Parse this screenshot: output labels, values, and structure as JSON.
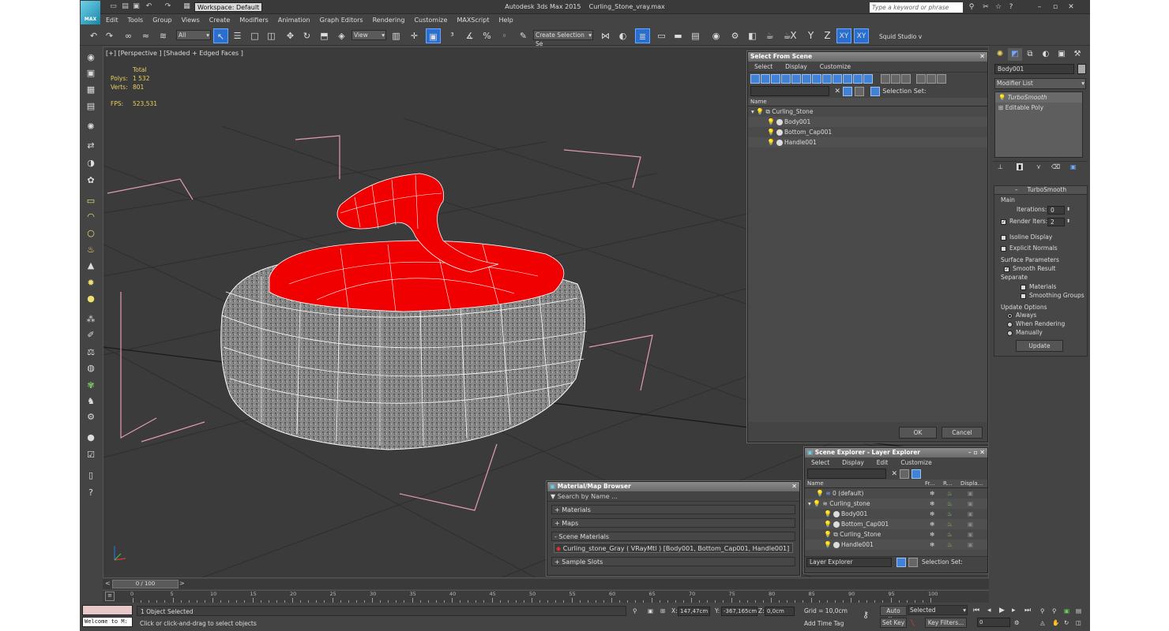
{
  "title": {
    "app": "Autodesk 3ds Max  2015",
    "file": "Curling_Stone_vray.max",
    "logo_text": "MAX",
    "workspace": "Workspace: Default",
    "search_placeholder": "Type a keyword or phrase"
  },
  "menu": [
    "Edit",
    "Tools",
    "Group",
    "Views",
    "Create",
    "Modifiers",
    "Animation",
    "Graph Editors",
    "Rendering",
    "Customize",
    "MAXScript",
    "Help"
  ],
  "toolbar": {
    "filter": "All",
    "ref_coord": "View",
    "selection_set": "Create Selection Se",
    "axes": [
      "X",
      "Y",
      "Z",
      "XY",
      "XY"
    ],
    "squid": "Squid Studio v"
  },
  "viewport": {
    "label": "[+] [Perspective ] [Shaded + Edged Faces ]",
    "stats": {
      "total_label": "Total",
      "polys_label": "Polys:",
      "polys": "1 532",
      "verts_label": "Verts:",
      "verts": "801",
      "fps_label": "FPS:",
      "fps": "523,531"
    }
  },
  "command_panel": {
    "object_name": "Body001",
    "modifier_list": "Modifier List",
    "stack": [
      "TurboSmooth",
      "Editable Poly"
    ],
    "rollout_title": "TurboSmooth",
    "main": "Main",
    "iterations_label": "Iterations:",
    "iterations": "0",
    "render_iters_label": "Render Iters:",
    "render_iters": "2",
    "isoline": "Isoline Display",
    "explicit_normals": "Explicit Normals",
    "surface_params": "Surface Parameters",
    "smooth_result": "Smooth Result",
    "separate": "Separate",
    "materials": "Materials",
    "smoothing_groups": "Smoothing Groups",
    "update_options": "Update Options",
    "always": "Always",
    "when_rendering": "When Rendering",
    "manually": "Manually",
    "update_btn": "Update"
  },
  "select_from_scene": {
    "title": "Select From Scene",
    "menu": [
      "Select",
      "Display",
      "Customize"
    ],
    "selection_set": "Selection Set:",
    "col_name": "Name",
    "rows": [
      "Curling_Stone",
      "Body001",
      "Bottom_Cap001",
      "Handle001"
    ],
    "ok": "OK",
    "cancel": "Cancel"
  },
  "scene_explorer": {
    "title": "Scene Explorer - Layer Explorer",
    "menu": [
      "Select",
      "Display",
      "Edit",
      "Customize"
    ],
    "cols": [
      "Name",
      "Fr...",
      "R...",
      "Displa..."
    ],
    "rows": [
      "0 (default)",
      "Curling_stone",
      "Body001",
      "Bottom_Cap001",
      "Curling_Stone",
      "Handle001"
    ],
    "footer_combo": "Layer Explorer",
    "footer_set": "Selection Set:"
  },
  "material_browser": {
    "title": "Material/Map Browser",
    "search": "Search by Name ...",
    "sections": [
      "+ Materials",
      "+ Maps",
      "- Scene Materials",
      "+ Sample Slots"
    ],
    "material": "Curling_stone_Gray  ( VRayMtl ) [Body001, Bottom_Cap001, Handle001]"
  },
  "timeline": {
    "frame": "0 / 100",
    "ticks": [
      "0",
      "5",
      "10",
      "15",
      "20",
      "25",
      "30",
      "35",
      "40",
      "45",
      "50",
      "55",
      "60",
      "65",
      "70",
      "75",
      "80",
      "85",
      "90",
      "95",
      "100"
    ]
  },
  "status": {
    "maxscript": "Welcome to M:",
    "selected": "1 Object Selected",
    "prompt": "Click or click-and-drag to select objects",
    "x_label": "X:",
    "x": "147,47cm",
    "y_label": "Y:",
    "y": "-367,165cm",
    "z_label": "Z:",
    "z": "0,0cm",
    "grid": "Grid = 10,0cm",
    "add_time_tag": "Add Time Tag",
    "auto_key": "Auto Key",
    "set_key": "Set Key",
    "selected_combo": "Selected",
    "key_filters": "Key Filters...",
    "frame_field": "0"
  }
}
